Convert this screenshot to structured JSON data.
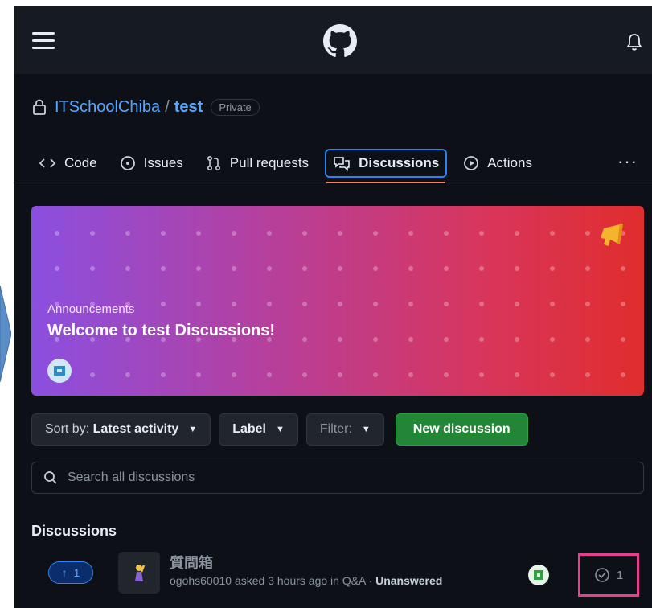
{
  "topbar": {
    "menu_icon": "hamburger-icon",
    "logo_icon": "github-logo-icon",
    "notifications_icon": "bell-icon"
  },
  "repo": {
    "owner": "ITSchoolChiba",
    "separator": "/",
    "name": "test",
    "visibility": "Private"
  },
  "tabs": [
    {
      "label": "Code",
      "icon": "code-icon"
    },
    {
      "label": "Issues",
      "icon": "issue-opened-icon"
    },
    {
      "label": "Pull requests",
      "icon": "git-pull-request-icon"
    },
    {
      "label": "Discussions",
      "icon": "comment-discussion-icon",
      "active": true
    },
    {
      "label": "Actions",
      "icon": "play-icon"
    }
  ],
  "more_label": "···",
  "banner": {
    "category": "Announcements",
    "title": "Welcome to test Discussions!",
    "icon": "megaphone-icon",
    "colors": [
      "#8b4fe0",
      "#e02d2d"
    ]
  },
  "filters": {
    "sort_prefix": "Sort by:",
    "sort_value": "Latest activity",
    "label_button": "Label",
    "filter_button": "Filter:",
    "new_discussion": "New discussion"
  },
  "search": {
    "placeholder": "Search all discussions"
  },
  "section_title": "Discussions",
  "discussions": [
    {
      "upvotes": "1",
      "title": "質問箱",
      "meta": "ogohs60010 asked 3 hours ago in Q&A ·",
      "status": "Unanswered",
      "comments": "1"
    }
  ],
  "colors": {
    "accent_blue": "#2f81f7",
    "green_button": "#238636",
    "highlight_pink": "#e83e8c"
  }
}
